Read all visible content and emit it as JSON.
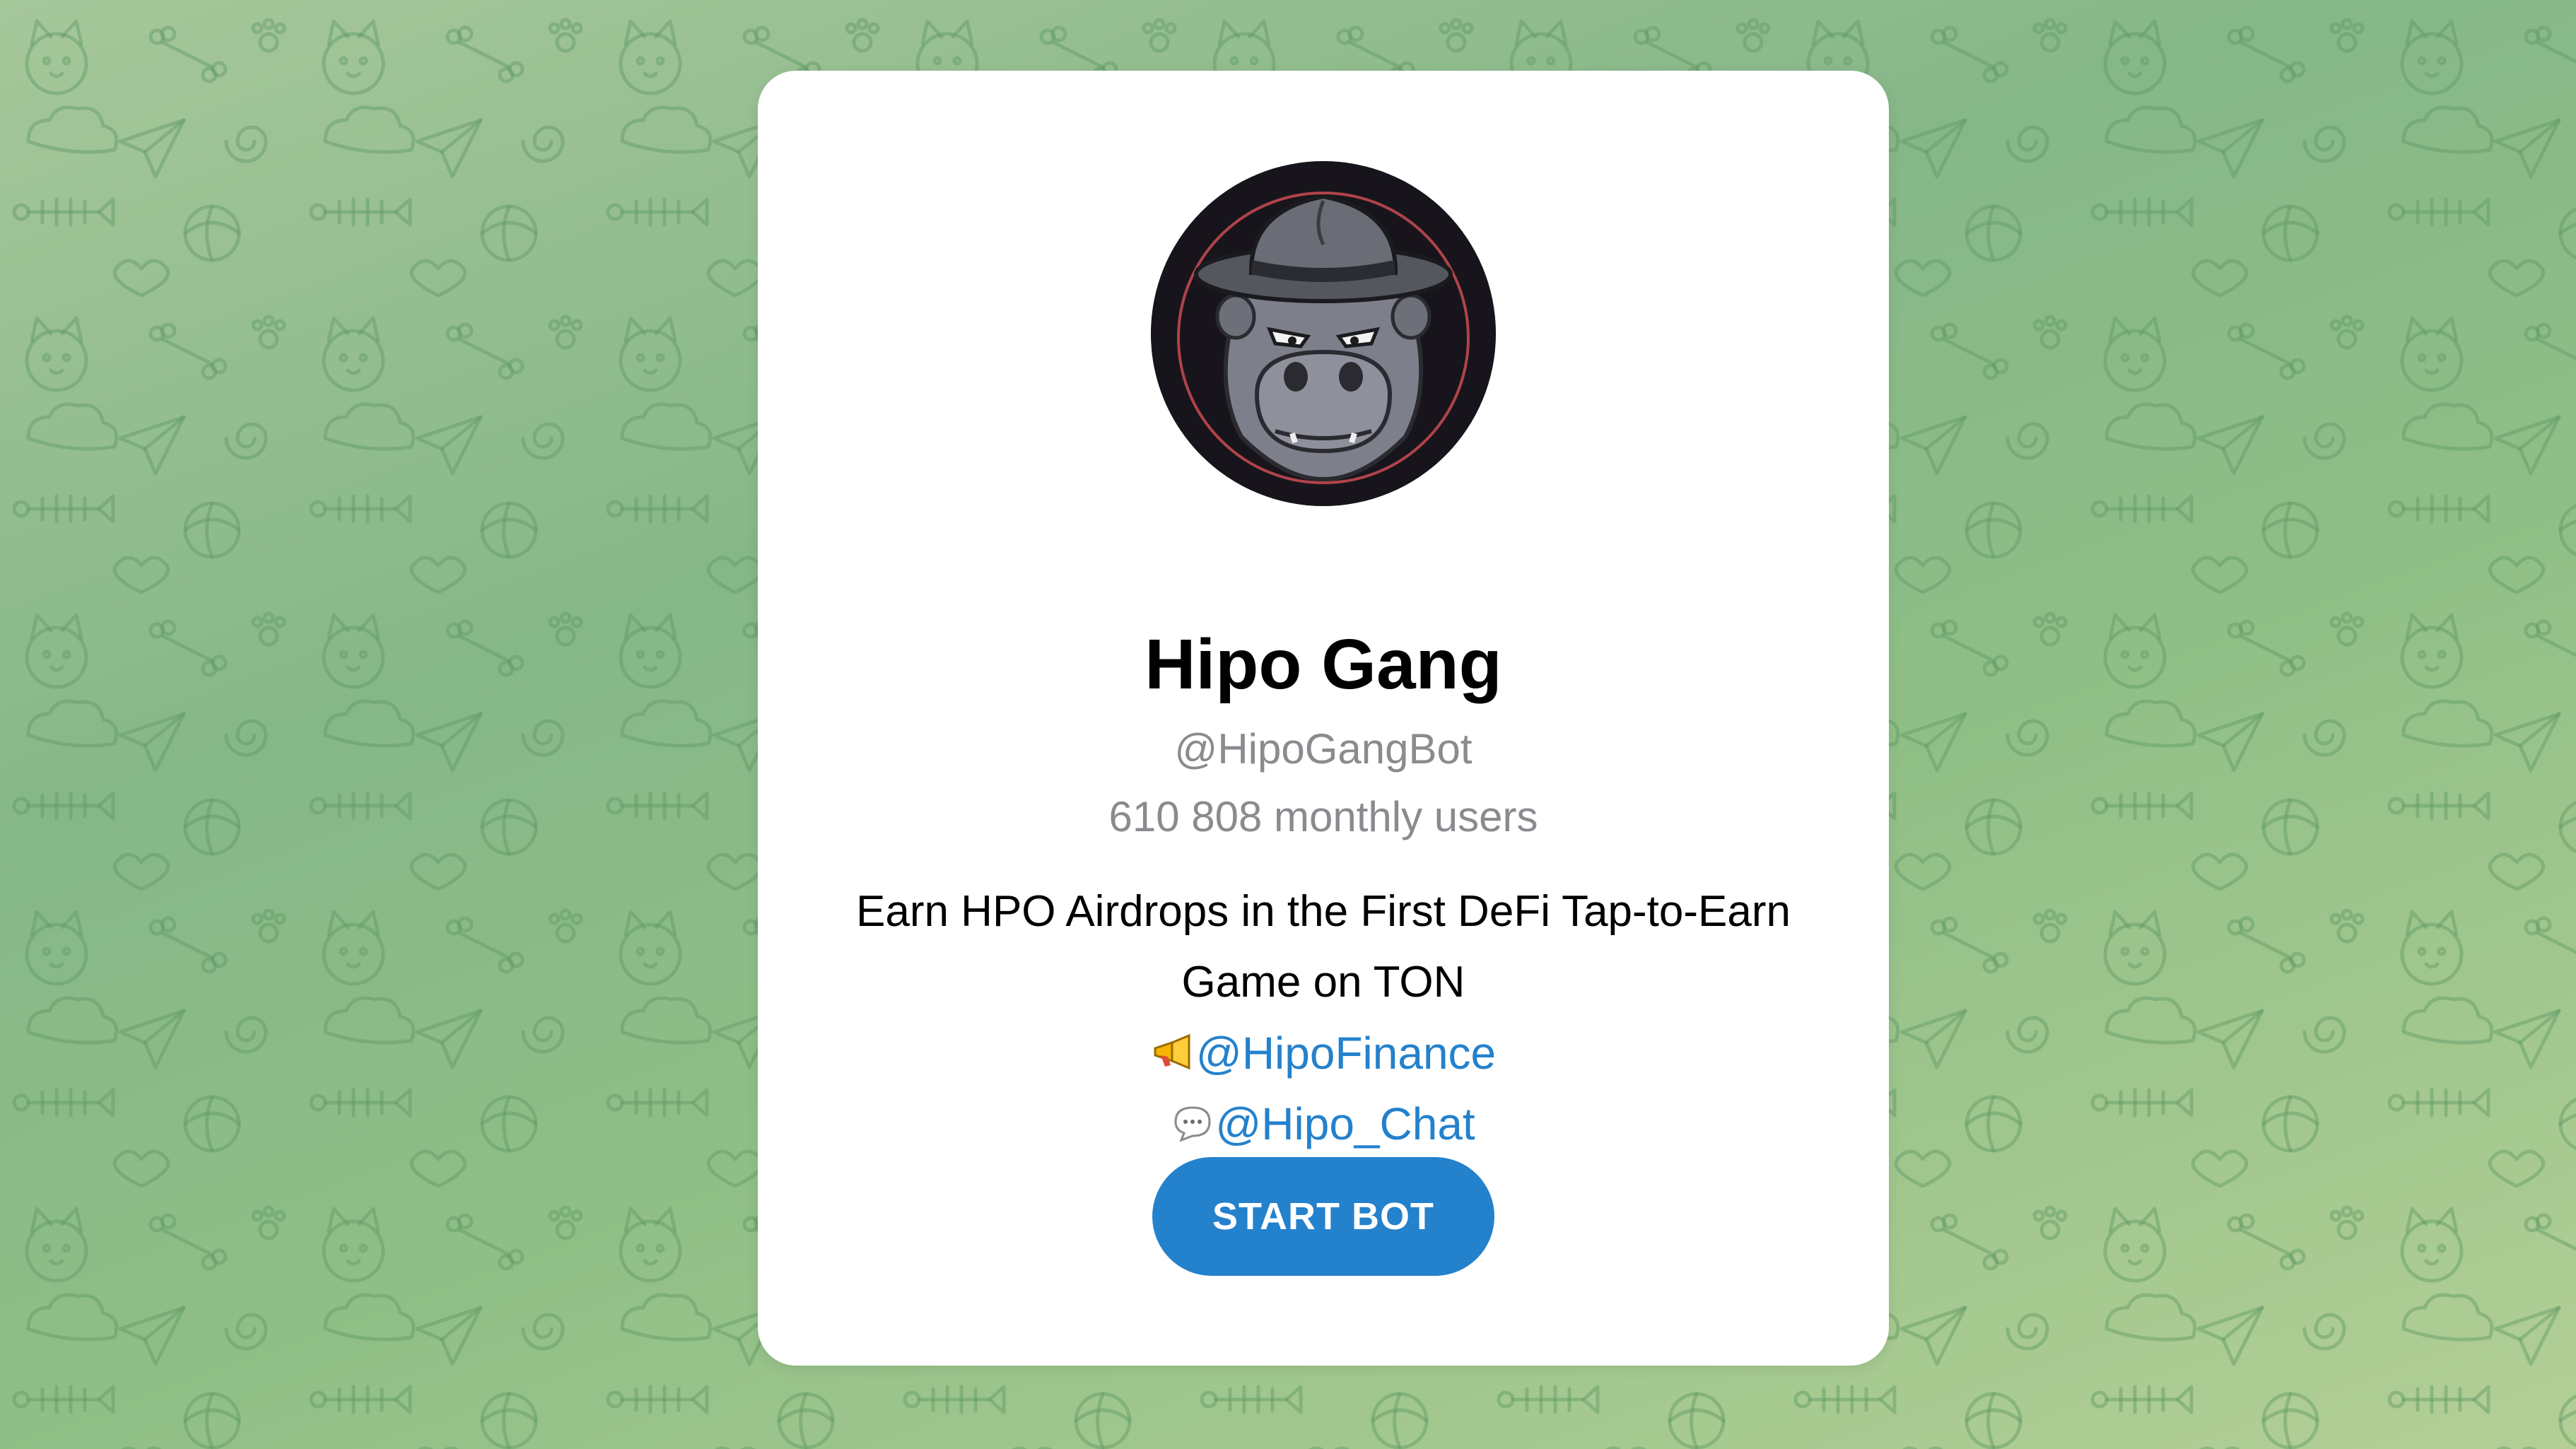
{
  "bot": {
    "name": "Hipo Gang",
    "username": "@HipoGangBot",
    "monthly_users": "610 808 monthly users",
    "description": "Earn HPO Airdrops in the First DeFi Tap-to-Earn Game on TON",
    "links": [
      {
        "icon": "megaphone-icon",
        "text": "@HipoFinance"
      },
      {
        "icon": "speech-bubble-icon",
        "text": "@Hipo_Chat"
      }
    ],
    "start_label": "START BOT"
  },
  "colors": {
    "accent": "#2481cc",
    "muted_text": "#8a8a8f",
    "card": "#ffffff"
  },
  "avatar_icon": "hippo-with-fedora-avatar",
  "background_icon": "doodle-pattern-background"
}
